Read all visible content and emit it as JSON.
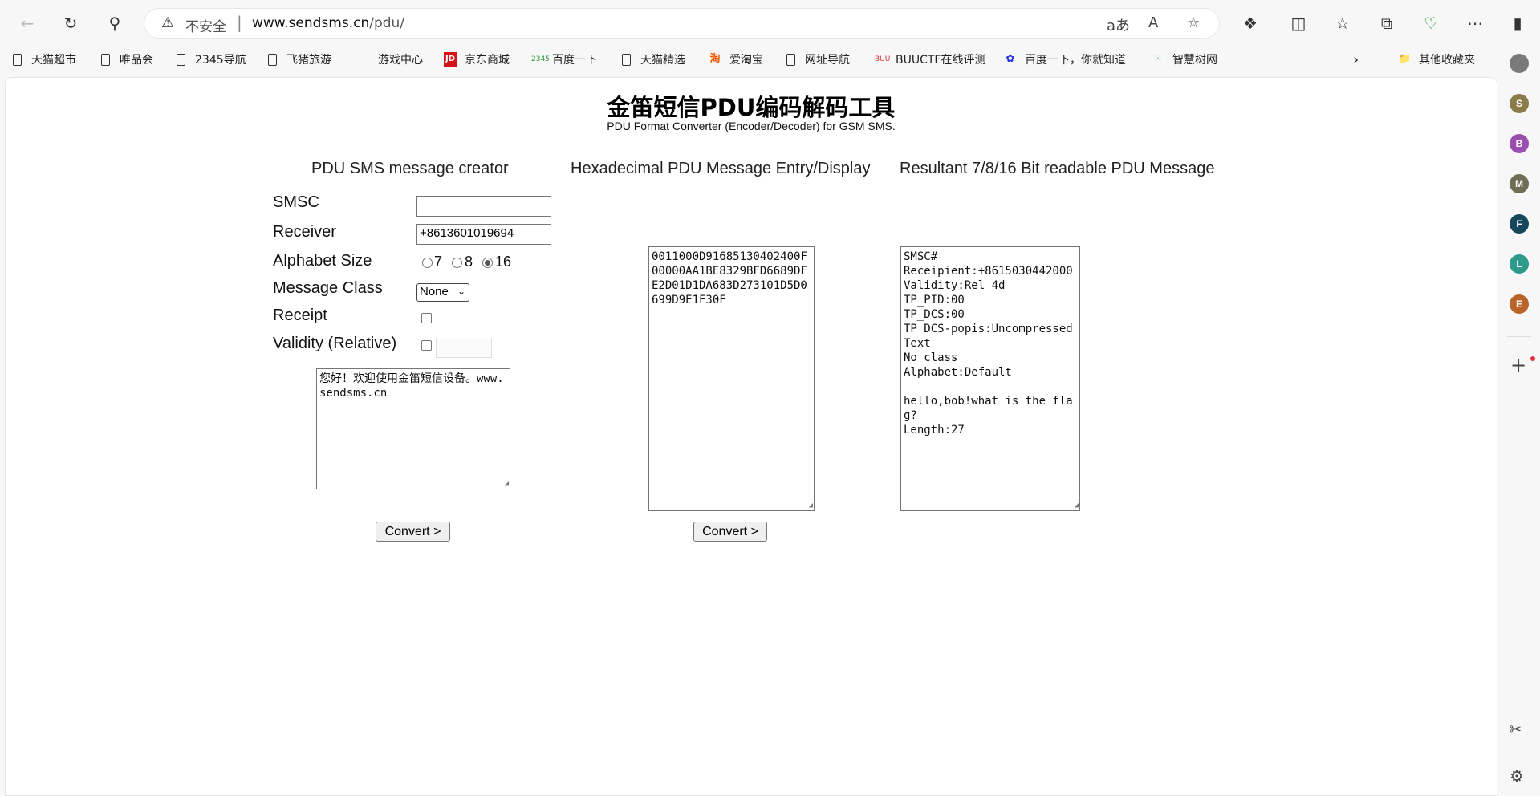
{
  "browser": {
    "security_label": "不安全",
    "url_host": "www.sendsms.cn",
    "url_path": "/pdu/",
    "translate_icon": "aあ",
    "read_aloud_icon": "A"
  },
  "bookmarks": [
    {
      "label": "天猫超市",
      "icon": "file-icon"
    },
    {
      "label": "唯品会",
      "icon": "file-icon"
    },
    {
      "label": "2345导航",
      "icon": "file-icon"
    },
    {
      "label": "飞猪旅游",
      "icon": "file-icon"
    },
    {
      "label": "游戏中心",
      "icon": "none"
    },
    {
      "label": "京东商城",
      "icon": "jd-icon"
    },
    {
      "label": "百度一下",
      "icon": "2345-icon"
    },
    {
      "label": "天猫精选",
      "icon": "file-icon"
    },
    {
      "label": "爱淘宝",
      "icon": "taobao-icon"
    },
    {
      "label": "网址导航",
      "icon": "file-icon"
    },
    {
      "label": "BUUCTF在线评测",
      "icon": "buu-icon"
    },
    {
      "label": "百度一下，你就知道",
      "icon": "baidu-paw-icon"
    },
    {
      "label": "智慧树网",
      "icon": "zhihuishu-icon"
    }
  ],
  "bookmarks_folder": "其他收藏夹",
  "rail": {
    "avatars": [
      {
        "letter": "",
        "color": "#7a7a7a"
      },
      {
        "letter": "S",
        "color": "#8b7a4a"
      },
      {
        "letter": "B",
        "color": "#9a4fb0"
      },
      {
        "letter": "M",
        "color": "#6e6e58"
      },
      {
        "letter": "F",
        "color": "#17475a"
      },
      {
        "letter": "L",
        "color": "#2e9a8a"
      },
      {
        "letter": "E",
        "color": "#b8642a"
      }
    ]
  },
  "page": {
    "title": "金笛短信PDU编码解码工具",
    "subtitle": "PDU Format Converter (Encoder/Decoder) for GSM SMS.",
    "col1_heading": "PDU SMS message creator",
    "col2_heading": "Hexadecimal PDU Message Entry/Display",
    "col3_heading": "Resultant 7/8/16 Bit readable PDU Message"
  },
  "form": {
    "smsc_label": "SMSC",
    "smsc_value": "",
    "receiver_label": "Receiver",
    "receiver_value": "+8613601019694",
    "alphabet_label": "Alphabet Size",
    "alphabet_options": [
      "7",
      "8",
      "16"
    ],
    "alphabet_selected": "16",
    "class_label": "Message Class",
    "class_value": "None",
    "receipt_label": "Receipt",
    "receipt_checked": false,
    "validity_label": "Validity (Relative)",
    "validity_checked": false,
    "validity_value": "",
    "message_text": "您好！欢迎使用金笛短信设备。www.sendsms.cn",
    "convert_label": "Convert >"
  },
  "hex": {
    "pdu_text": "0011000D91685130402400F00000AA1BE8329BFD6689DFE2D01D1DA683D273101D5D0699D9E1F30F",
    "convert_label": "Convert >"
  },
  "result": {
    "text": "SMSC#\nReceipient:+8615030442000\nValidity:Rel 4d\nTP_PID:00\nTP_DCS:00\nTP_DCS-popis:Uncompressed Text\nNo class\nAlphabet:Default\n\nhello,bob!what is the flag?\nLength:27"
  }
}
